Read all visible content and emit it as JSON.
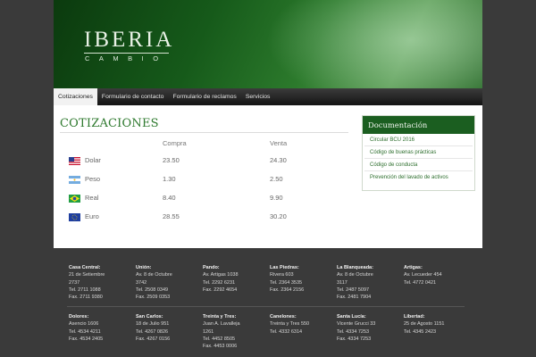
{
  "brand": {
    "logo_main": "IBERIA",
    "logo_sub": "CAMBIO"
  },
  "nav": [
    {
      "label": "Cotizaciones",
      "active": true
    },
    {
      "label": "Formulario de contacto",
      "active": false
    },
    {
      "label": "Formulario de reclamos",
      "active": false
    },
    {
      "label": "Servicios",
      "active": false
    }
  ],
  "main": {
    "title": "COTIZACIONES",
    "col_buy": "Compra",
    "col_sell": "Venta",
    "rows": [
      {
        "currency": "Dolar",
        "buy": "23.50",
        "sell": "24.30",
        "flag": "us-flag-icon"
      },
      {
        "currency": "Peso",
        "buy": "1.30",
        "sell": "2.50",
        "flag": "argentina-flag-icon"
      },
      {
        "currency": "Real",
        "buy": "8.40",
        "sell": "9.90",
        "flag": "brazil-flag-icon"
      },
      {
        "currency": "Euro",
        "buy": "28.55",
        "sell": "30.20",
        "flag": "eu-flag-icon"
      }
    ]
  },
  "sidebar": {
    "title": "Documentación",
    "links": [
      "Circular BCU 2016",
      "Código de buenas prácticas",
      "Código de conducta",
      "Prevención del lavado de activos"
    ]
  },
  "footer": {
    "offices": [
      {
        "name": "Casa Central:",
        "lines": [
          "21 de Setiembre",
          "2737",
          "Tel. 2711 1088",
          "Fax. 2711 9380"
        ]
      },
      {
        "name": "Unión:",
        "lines": [
          "Av. 8 de Octubre",
          "3742",
          "Tel. 2508 0349",
          "Fax. 2509 0353"
        ]
      },
      {
        "name": "Pando:",
        "lines": [
          "Av. Artigas 1038",
          "Tel. 2292 6231",
          "Fax. 2292 4654"
        ]
      },
      {
        "name": "Las Piedras:",
        "lines": [
          "Rivera 603",
          "Tel. 2364 3535",
          "Fax. 2364 2156"
        ]
      },
      {
        "name": "La Blanqueada:",
        "lines": [
          "Av. 8 de Octubre",
          "3117",
          "Tel. 2487 5097",
          "Fax. 2481 7904"
        ]
      },
      {
        "name": "Artigas:",
        "lines": [
          "Av. Lecueder 454",
          "Tel. 4772 0421"
        ]
      },
      {
        "name": "Dolores:",
        "lines": [
          "Asencio 1606",
          "Tel. 4534 4211",
          "Fax. 4534 2405"
        ]
      },
      {
        "name": "San Carlos:",
        "lines": [
          "18 de Julio 951",
          "Tel. 4267 0826",
          "Fax. 4267 0156"
        ]
      },
      {
        "name": "Treinta y Tres:",
        "lines": [
          "Juan A. Lavalleja",
          "1261",
          "Tel. 4452 8505",
          "Fax. 4453 0006"
        ]
      },
      {
        "name": "Canelones:",
        "lines": [
          "Treinta y Tres 550",
          "Tel. 4332 6314"
        ]
      },
      {
        "name": "Santa Lucía:",
        "lines": [
          "Vicente Grucci 33",
          "Tel. 4334 7253",
          "Fax. 4334 7253"
        ]
      },
      {
        "name": "Libertad:",
        "lines": [
          "25 de Agosto 1151",
          "Tel. 4345 2423"
        ]
      }
    ]
  },
  "colors": {
    "brand_green": "#1b5e20",
    "title_green": "#2f7a2f",
    "footer_bg": "#3a3a3a"
  }
}
